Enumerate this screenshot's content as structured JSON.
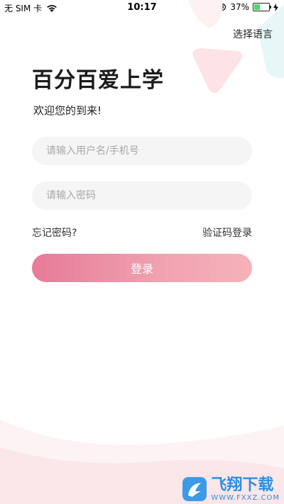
{
  "status_bar": {
    "carrier": "无 SIM 卡",
    "time": "10:17",
    "battery": "37%",
    "battery_level": 0.37
  },
  "header": {
    "language_label": "选择语言"
  },
  "brand": {
    "title": "百分百爱上学",
    "subtitle": "欢迎您的到来!"
  },
  "form": {
    "username_placeholder": "请输入用户名/手机号",
    "password_placeholder": "请输入密码",
    "forgot_label": "忘记密码?",
    "code_login_label": "验证码登录",
    "login_label": "登录"
  },
  "watermark": {
    "name": "飞翔下载",
    "url": "WWW.FXXZ.COM"
  },
  "colors": {
    "accent_start": "#e77a98",
    "accent_end": "#f6b2b8",
    "field_bg": "#f5f5f5"
  }
}
